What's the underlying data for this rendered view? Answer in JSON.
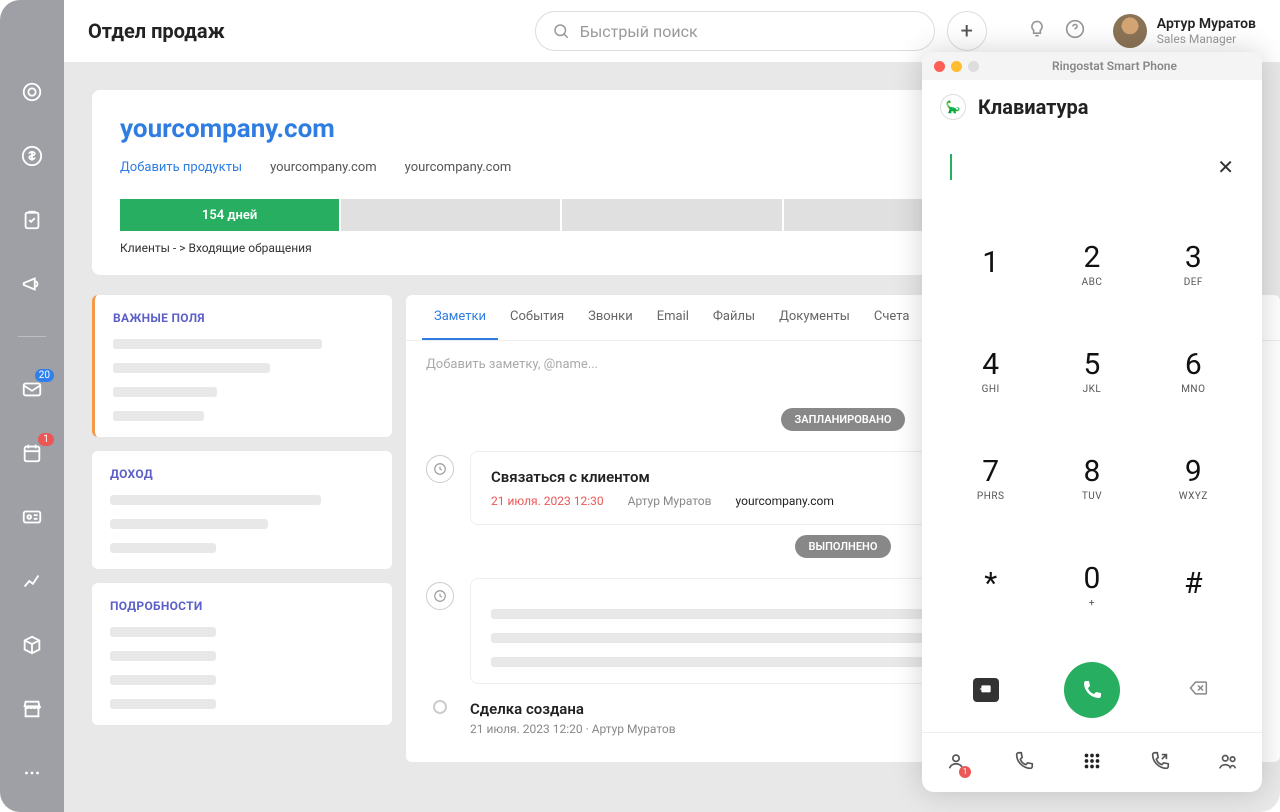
{
  "header": {
    "title": "Отдел продаж",
    "search_placeholder": "Быстрый поиск",
    "user_name": "Артур Муратов",
    "user_role": "Sales Manager"
  },
  "nav": {
    "mail_badge": "20",
    "cal_badge": "1"
  },
  "deal": {
    "company": "yourcompany.com",
    "owner_name": "Артур Муратов",
    "owner_role": "Sales Manager",
    "breadcrumb": {
      "add_products": "Добавить продукты",
      "c1": "yourcompany.com",
      "c2": "yourcompany.com"
    },
    "stage_label": "154 дней",
    "pipeline_path": "Клиенты - > Входящие обращения"
  },
  "panels": {
    "important": "ВАЖНЫЕ ПОЛЯ",
    "income": "ДОХОД",
    "details": "ПОДРОБНОСТИ"
  },
  "tabs": [
    "Заметки",
    "События",
    "Звонки",
    "Email",
    "Файлы",
    "Документы",
    "Счета"
  ],
  "note_placeholder": "Добавить заметку, @name...",
  "timeline": {
    "pill_planned": "ЗАПЛАНИРОВАНО",
    "pill_done": "ВЫПОЛНЕНО",
    "task": {
      "title": "Связаться с клиентом",
      "date": "21 июля. 2023 12:30",
      "author": "Артур Муратов",
      "company": "yourcompany.com"
    },
    "created": {
      "title": "Сделка создана",
      "sub": "21 июля. 2023 12:20 · Артур Муратов"
    }
  },
  "phone": {
    "window_title": "Ringostat Smart Phone",
    "header_title": "Клавиатура",
    "keys": [
      {
        "n": "1",
        "s": ""
      },
      {
        "n": "2",
        "s": "ABC"
      },
      {
        "n": "3",
        "s": "DEF"
      },
      {
        "n": "4",
        "s": "GHI"
      },
      {
        "n": "5",
        "s": "JKL"
      },
      {
        "n": "6",
        "s": "MNO"
      },
      {
        "n": "7",
        "s": "PHRS"
      },
      {
        "n": "8",
        "s": "TUV"
      },
      {
        "n": "9",
        "s": "WXYZ"
      },
      {
        "n": "*",
        "s": ""
      },
      {
        "n": "0",
        "s": "+"
      },
      {
        "n": "#",
        "s": ""
      }
    ],
    "nav_badge": "1"
  }
}
